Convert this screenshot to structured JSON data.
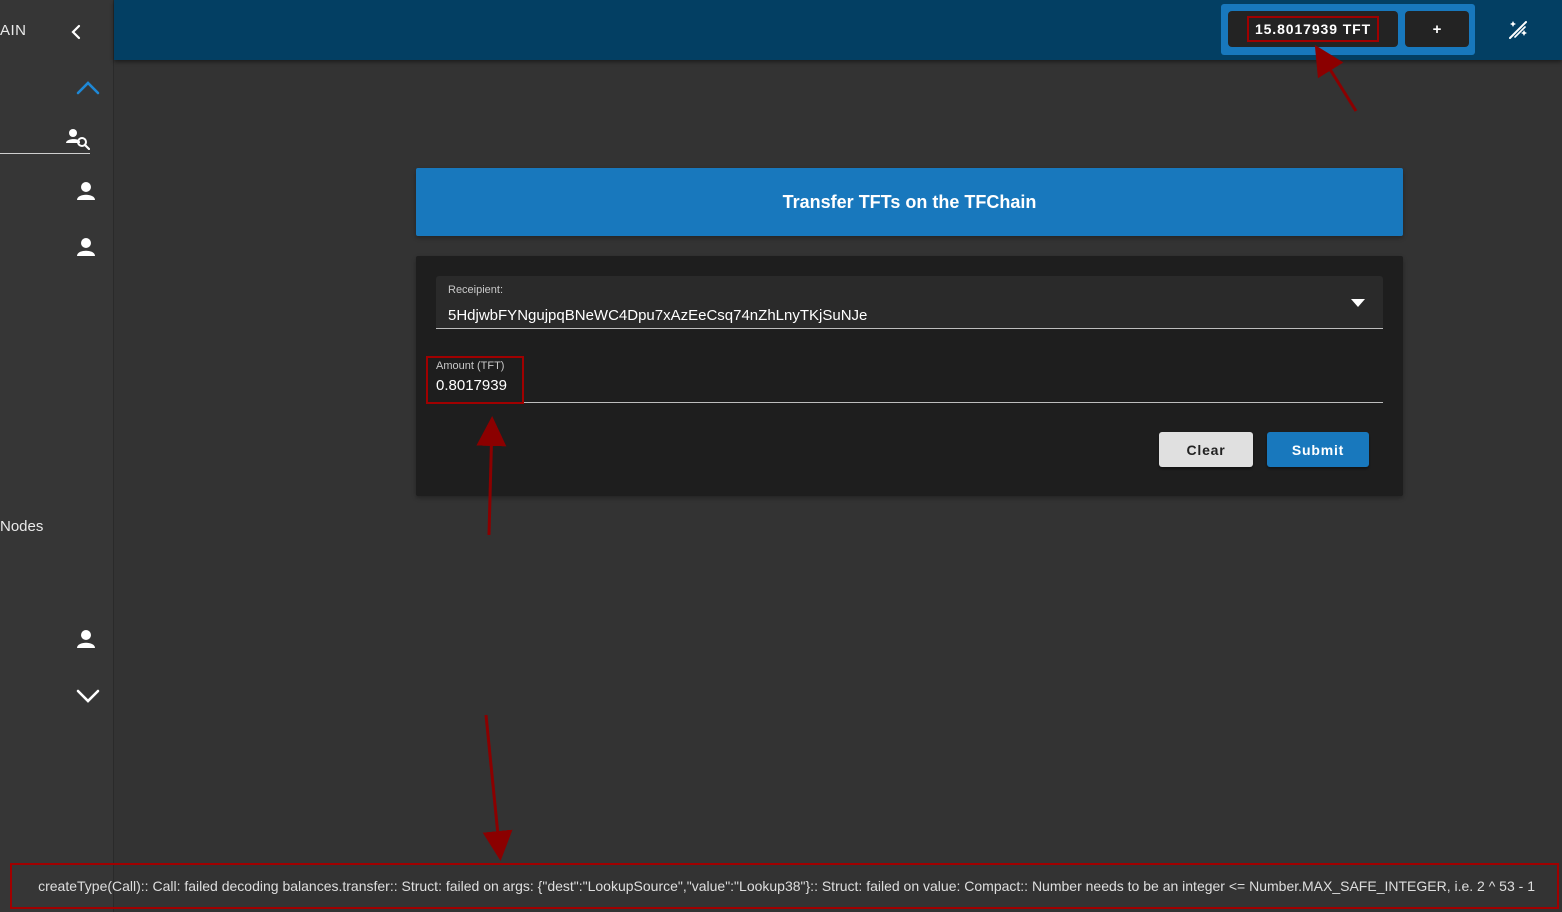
{
  "sidebar": {
    "title_fragment": "AIN",
    "nodes_fragment": "Nodes",
    "icons": {
      "collapse": "chevron-left-icon",
      "expand_up": "chevron-up-icon",
      "search": "account-search-icon",
      "person": "person-icon",
      "expand_down": "chevron-down-icon"
    }
  },
  "topbar": {
    "balance": "15.8017939 TFT",
    "add_label": "+",
    "theme_icon": "theme-toggle-icon"
  },
  "main": {
    "title": "Transfer TFTs on the TFChain",
    "form": {
      "recipient_label": "Receipient:",
      "recipient_value": "5HdjwbFYNgujpqBNeWC4Dpu7xAzEeCsq74nZhLnyTKjSuNJe",
      "amount_label": "Amount (TFT)",
      "amount_value": "0.8017939",
      "clear_label": "Clear",
      "submit_label": "Submit"
    }
  },
  "error": {
    "message": "createType(Call):: Call: failed decoding balances.transfer:: Struct: failed on args: {\"dest\":\"LookupSource\",\"value\":\"Lookup38\"}:: Struct: failed on value: Compact:: Number needs to be an integer <= Number.MAX_SAFE_INTEGER, i.e. 2 ^ 53 - 1"
  },
  "colors": {
    "topbar": "#033f63",
    "accent": "#1878bd",
    "background": "#333333",
    "card": "#1e1e1e",
    "annotation": "#a00000"
  }
}
